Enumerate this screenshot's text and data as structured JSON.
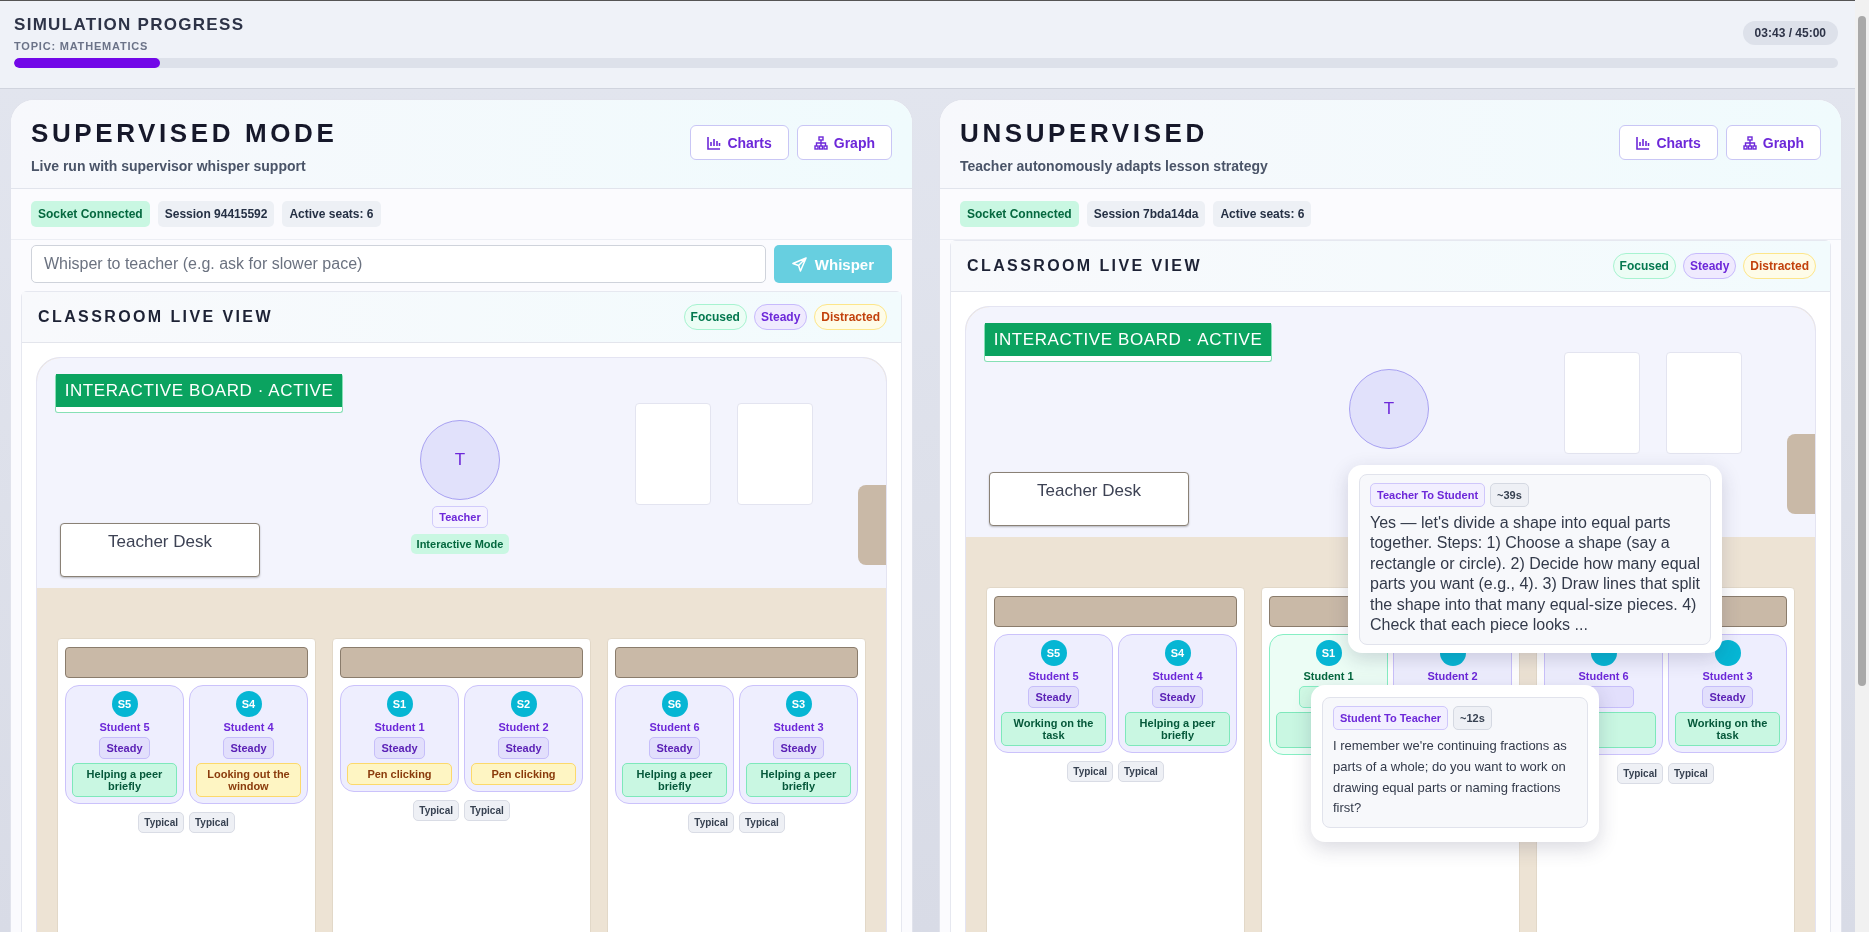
{
  "progress": {
    "title": "SIMULATION PROGRESS",
    "topic": "TOPIC: MATHEMATICS",
    "level": 0.08,
    "timer": "03:43 / 45:00"
  },
  "panels": [
    {
      "title": "SUPERVISED MODE",
      "subtitle": "Live run with supervisor whisper support",
      "buttons": [
        {
          "label": "Charts",
          "kind": "charts"
        },
        {
          "label": "Graph",
          "kind": "graph"
        }
      ],
      "chips": [
        {
          "label": "Socket Connected",
          "kind": "success"
        },
        {
          "label": "Session 94415592",
          "kind": "neutral"
        },
        {
          "label": "Active seats: 6",
          "kind": "neutral"
        }
      ],
      "whisper": {
        "placeholder": "Whisper to teacher (e.g. ask for slower pace)",
        "button": "Whisper"
      },
      "classroom": {
        "title": "CLASSROOM LIVE VIEW",
        "legend": [
          {
            "label": "Focused",
            "kind": "focused"
          },
          {
            "label": "Steady",
            "kind": "steady"
          },
          {
            "label": "Distracted",
            "kind": "distracted"
          }
        ],
        "board": "INTERACTIVE BOARD · ACTIVE",
        "desk": "Teacher Desk",
        "teacher": {
          "initial": "T",
          "label": "Teacher",
          "mode": "Interactive Mode"
        },
        "groups": [
          {
            "students": [
              {
                "avatar": "S5",
                "name": "Student 5",
                "focused": false,
                "status": "Steady",
                "activity": {
                  "label": "Helping a peer briefly",
                  "kind": "positive"
                }
              },
              {
                "avatar": "S4",
                "name": "Student 4",
                "focused": false,
                "status": "Steady",
                "activity": {
                  "label": "Looking out the window",
                  "kind": "distraction"
                }
              }
            ],
            "tags": [
              "Typical",
              "Typical"
            ]
          },
          {
            "students": [
              {
                "avatar": "S1",
                "name": "Student 1",
                "focused": false,
                "status": "Steady",
                "activity": {
                  "label": "Pen clicking",
                  "kind": "distraction"
                }
              },
              {
                "avatar": "S2",
                "name": "Student 2",
                "focused": false,
                "status": "Steady",
                "activity": {
                  "label": "Pen clicking",
                  "kind": "distraction"
                }
              }
            ],
            "tags": [
              "Typical",
              "Typical"
            ]
          },
          {
            "students": [
              {
                "avatar": "S6",
                "name": "Student 6",
                "focused": false,
                "status": "Steady",
                "activity": {
                  "label": "Helping a peer briefly",
                  "kind": "positive"
                }
              },
              {
                "avatar": "S3",
                "name": "Student 3",
                "focused": false,
                "status": "Steady",
                "activity": {
                  "label": "Helping a peer briefly",
                  "kind": "positive"
                }
              }
            ],
            "tags": [
              "Typical",
              "Typical"
            ]
          }
        ]
      }
    },
    {
      "title": "UNSUPERVISED",
      "subtitle": "Teacher autonomously adapts lesson strategy",
      "buttons": [
        {
          "label": "Charts",
          "kind": "charts"
        },
        {
          "label": "Graph",
          "kind": "graph"
        }
      ],
      "chips": [
        {
          "label": "Socket Connected",
          "kind": "success"
        },
        {
          "label": "Session 7bda14da",
          "kind": "neutral"
        },
        {
          "label": "Active seats: 6",
          "kind": "neutral"
        }
      ],
      "classroom": {
        "title": "CLASSROOM LIVE VIEW",
        "legend": [
          {
            "label": "Focused",
            "kind": "focused"
          },
          {
            "label": "Steady",
            "kind": "steady"
          },
          {
            "label": "Distracted",
            "kind": "distracted"
          }
        ],
        "board": "INTERACTIVE BOARD · ACTIVE",
        "desk": "Teacher Desk",
        "teacher": {
          "initial": "T"
        },
        "groups": [
          {
            "students": [
              {
                "avatar": "S5",
                "name": "Student 5",
                "focused": false,
                "status": "Steady",
                "activity": {
                  "label": "Working on the task",
                  "kind": "positive"
                }
              },
              {
                "avatar": "S4",
                "name": "Student 4",
                "focused": false,
                "status": "Steady",
                "activity": {
                  "label": "Helping a peer briefly",
                  "kind": "positive"
                }
              }
            ],
            "tags": [
              "Typical",
              "Typical"
            ]
          },
          {
            "students": [
              {
                "avatar": "S1",
                "name": "Student 1",
                "focused": true,
                "activity": {
                  "kind": "positive"
                }
              },
              {
                "name": "Student 2",
                "focused": false
              }
            ]
          },
          {
            "students": [
              {
                "name": "Student 6",
                "focused": false,
                "activity": {
                  "kind": "positive"
                }
              },
              {
                "name": "Student 3",
                "focused": false,
                "status": "Steady",
                "activity": {
                  "label": "Working on the task",
                  "kind": "positive"
                }
              }
            ],
            "tags": [
              "Typical",
              "Typical"
            ]
          }
        ],
        "bubbles": [
          {
            "kind": "teacher",
            "direction": "Teacher To Student",
            "time": "~39s",
            "text": "Yes — let's divide a shape into equal parts together. Steps: 1) Choose a shape (say a rectangle or circle). 2) Decide how many equal parts you want (e.g., 4). 3) Draw lines that split the shape into that many equal-size pieces. 4) Check that each piece looks ..."
          },
          {
            "kind": "student",
            "direction": "Student To Teacher",
            "time": "~12s",
            "text": "I remember we're continuing fractions as parts of a whole; do you want to work on drawing equal parts or naming fractions first?"
          }
        ]
      }
    }
  ]
}
